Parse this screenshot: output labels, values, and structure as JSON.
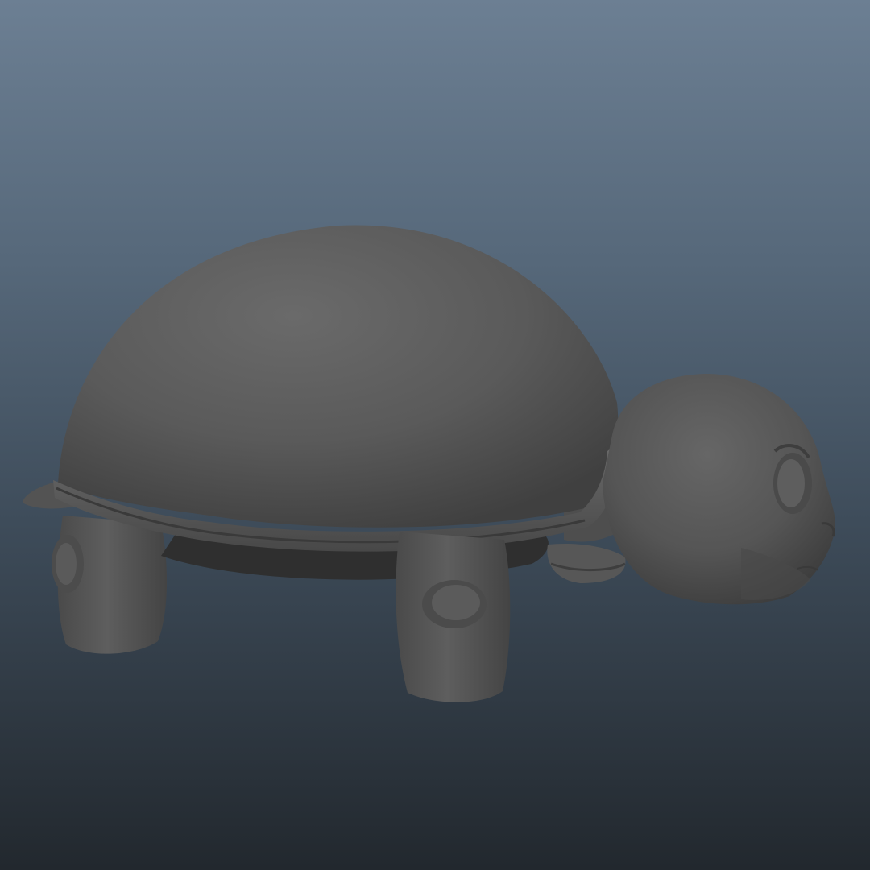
{
  "viewport": {
    "background_top": "#6c7f93",
    "background_bottom": "#22282e"
  },
  "model": {
    "subject": "turtle",
    "shading": "smooth-gray",
    "base_color": "#5a5a5a"
  }
}
